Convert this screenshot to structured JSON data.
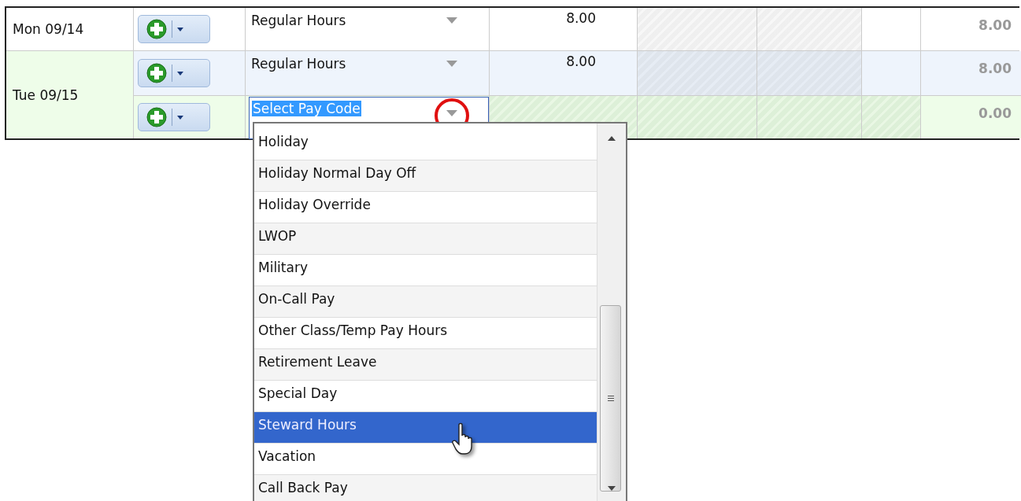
{
  "days": [
    {
      "date": "Mon 09/14",
      "selected": false,
      "entries": [
        {
          "selected": false,
          "shaded": false,
          "pay_code": "Regular Hours",
          "cells": [
            {
              "text": "8.00",
              "locked": false
            },
            {
              "locked": true
            },
            {
              "locked": true
            },
            {
              "locked": false
            }
          ],
          "total": "8.00"
        }
      ]
    },
    {
      "date": "Tue 09/15",
      "selected": true,
      "entries": [
        {
          "selected": false,
          "shaded": true,
          "pay_code": "Regular Hours",
          "cells": [
            {
              "text": "8.00",
              "locked": false
            },
            {
              "locked": true
            },
            {
              "locked": true
            },
            {
              "locked": false
            }
          ],
          "total": "8.00"
        },
        {
          "selected": true,
          "shaded": false,
          "pay_code": "Select Pay Code",
          "cells": [
            {
              "locked": true
            },
            {
              "locked": true
            },
            {
              "locked": true
            },
            {
              "locked": true
            }
          ],
          "total": "0.00"
        }
      ]
    }
  ],
  "dropdown": {
    "items": [
      {
        "label": "Holiday",
        "selected": false
      },
      {
        "label": "Holiday Normal Day Off",
        "selected": false
      },
      {
        "label": "Holiday Override",
        "selected": false
      },
      {
        "label": "LWOP",
        "selected": false
      },
      {
        "label": "Military",
        "selected": false
      },
      {
        "label": "On-Call Pay",
        "selected": false
      },
      {
        "label": "Other Class/Temp Pay Hours",
        "selected": false
      },
      {
        "label": "Retirement Leave",
        "selected": false
      },
      {
        "label": "Special Day",
        "selected": false
      },
      {
        "label": "Steward Hours",
        "selected": true
      },
      {
        "label": "Vacation",
        "selected": false
      },
      {
        "label": "Call Back Pay",
        "selected": false
      }
    ]
  }
}
